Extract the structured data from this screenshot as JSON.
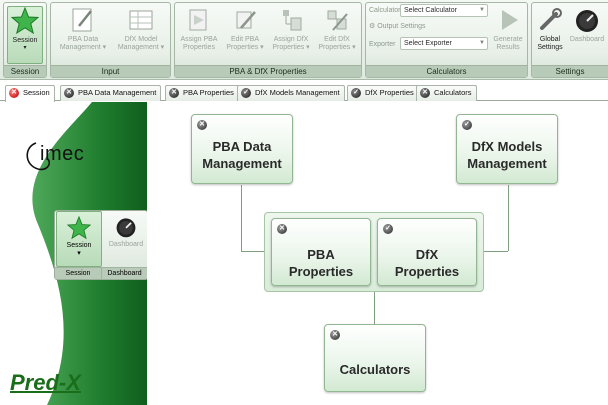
{
  "ribbon": {
    "session_group": {
      "button_label": "Session",
      "group_label": "Session"
    },
    "input_group": {
      "group_label": "Input",
      "pba_data_label_1": "PBA Data",
      "pba_data_label_2": "Management",
      "dfx_model_label_1": "DfX Model",
      "dfx_model_label_2": "Management"
    },
    "pba_dfx_group": {
      "group_label": "PBA & DfX Properties",
      "assign_pba_1": "Assign PBA",
      "assign_pba_2": "Properties",
      "edit_pba_1": "Edit PBA",
      "edit_pba_2": "Properties",
      "assign_dfx_1": "Assign DfX",
      "assign_dfx_2": "Properties",
      "edit_dfx_1": "Edit DfX",
      "edit_dfx_2": "Properties"
    },
    "calculators_group": {
      "group_label": "Calculators",
      "calculator_label": "Calculator",
      "calculator_value": "Select Calculator",
      "output_settings_label": "Output Settings",
      "exporter_label": "Exporter",
      "exporter_value": "Select Exporter",
      "generate_1": "Generate",
      "generate_2": "Results"
    },
    "settings_group": {
      "group_label": "Settings",
      "global_1": "Global",
      "global_2": "Settings",
      "dashboard_label": "Dashboard"
    }
  },
  "tabs": [
    {
      "label": "Session",
      "icon": "close-red-icon"
    },
    {
      "label": "PBA Data Management",
      "icon": "close-grey-icon"
    },
    {
      "label": "PBA Properties",
      "icon": "close-grey-icon"
    },
    {
      "label": "DfX Models Management",
      "icon": "check-grey-icon"
    },
    {
      "label": "DfX Properties",
      "icon": "check-grey-icon"
    },
    {
      "label": "Calculators",
      "icon": "close-grey-icon"
    }
  ],
  "sidebar": {
    "logo_text": "imec",
    "session_button": "Session",
    "dashboard_button": "Dashboard",
    "session_group_label": "Session",
    "dashboard_group_label": "Dashboard",
    "brand": "Pred-X"
  },
  "diagram": {
    "pba_data_management": {
      "line1": "PBA Data",
      "line2": "Management",
      "status": "x"
    },
    "dfx_models_management": {
      "line1": "DfX Models",
      "line2": "Management",
      "status": "check"
    },
    "pba_properties": {
      "line1": "PBA",
      "line2": "Properties",
      "status": "x"
    },
    "dfx_properties": {
      "line1": "DfX",
      "line2": "Properties",
      "status": "check"
    },
    "calculators": {
      "line1": "Calculators",
      "status": "x"
    }
  },
  "colors": {
    "ribbon_bg": "#e7efe7",
    "sidebar_green": "#1b7a2a",
    "node_border": "#91b691",
    "brand_green": "#1a6e1a",
    "tab_active_close": "#d21f1f"
  }
}
